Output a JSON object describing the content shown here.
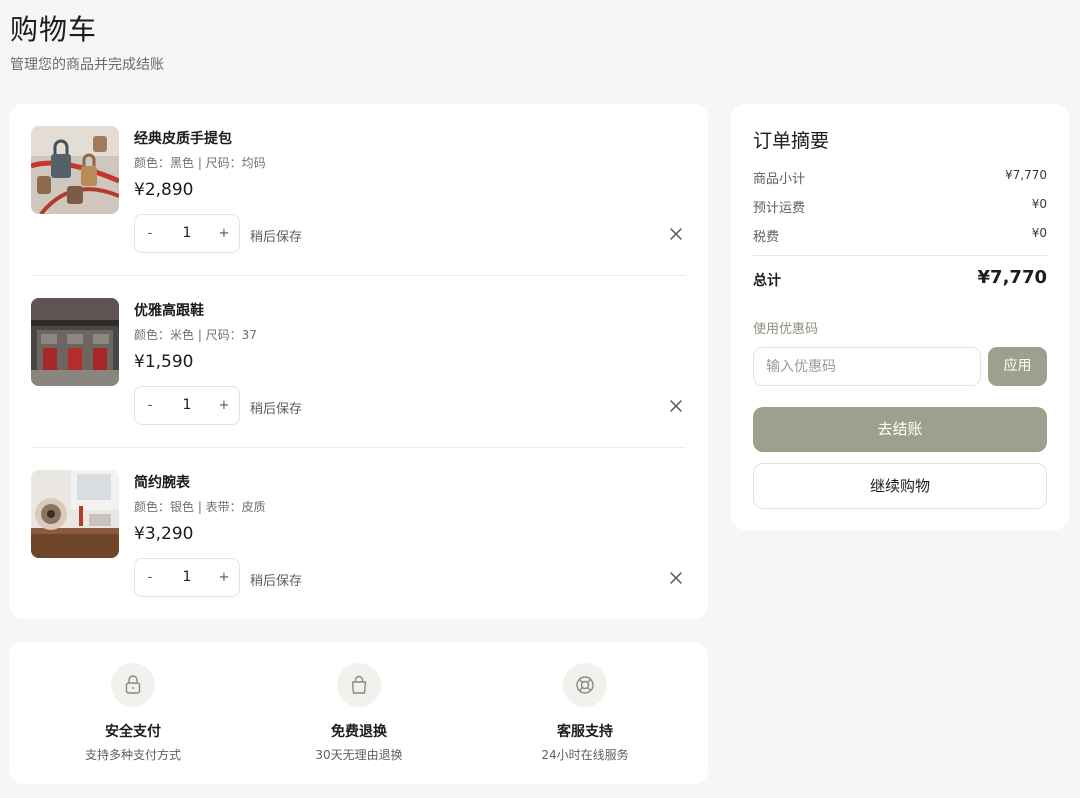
{
  "page": {
    "title": "购物车",
    "subtitle": "管理您的商品并完成结账"
  },
  "cart": {
    "save_later_label": "稍后保存",
    "items": [
      {
        "name": "经典皮质手提包",
        "meta": "颜色：黑色 | 尺码：均码",
        "price": "¥2,890",
        "quantity": "1",
        "image": "padlocks-photo"
      },
      {
        "name": "优雅高跟鞋",
        "meta": "颜色：米色 | 尺码：37",
        "price": "¥1,590",
        "quantity": "1",
        "image": "building-facade-photo"
      },
      {
        "name": "简约腕表",
        "meta": "颜色：银色 | 表带：皮质",
        "price": "¥3,290",
        "quantity": "1",
        "image": "desk-speaker-photo"
      }
    ],
    "qty_minus": "-",
    "qty_plus": "+"
  },
  "summary": {
    "title": "订单摘要",
    "rows": [
      {
        "label": "商品小计",
        "value": "¥7,770"
      },
      {
        "label": "预计运费",
        "value": "¥0"
      },
      {
        "label": "税费",
        "value": "¥0"
      }
    ],
    "total_label": "总计",
    "total_value": "¥7,770",
    "coupon_label": "使用优惠码",
    "coupon_placeholder": "输入优惠码",
    "apply_label": "应用",
    "checkout_label": "去结账",
    "continue_label": "继续购物"
  },
  "features": [
    {
      "title": "安全支付",
      "desc": "支持多种支付方式",
      "icon": "lock-icon"
    },
    {
      "title": "免费退换",
      "desc": "30天无理由退换",
      "icon": "shopping-bag-icon"
    },
    {
      "title": "客服支持",
      "desc": "24小时在线服务",
      "icon": "lifebuoy-icon"
    }
  ],
  "colors": {
    "accent": "#9ea08e",
    "background": "#f6f6f6",
    "card": "#ffffff"
  }
}
